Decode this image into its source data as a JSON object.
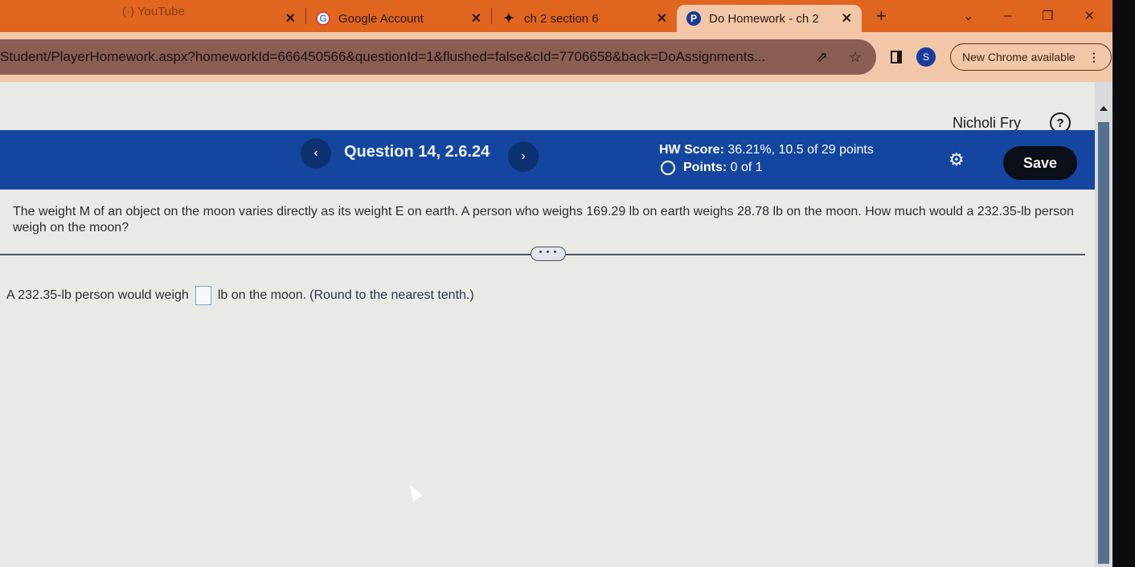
{
  "browser": {
    "tabs": [
      {
        "title": "(·) YouTube",
        "icon": "youtube-icon",
        "active": false,
        "partial": true
      },
      {
        "title": "Google Account",
        "icon": "google-icon",
        "active": false
      },
      {
        "title": "ch 2 section 6",
        "icon": "bird-icon",
        "active": false
      },
      {
        "title": "Do Homework - ch 2",
        "icon": "pearson-icon",
        "active": true
      }
    ],
    "tab_close_glyph": "✕",
    "new_tab_glyph": "+",
    "window_controls": {
      "dropdown": "⌄",
      "minimize": "–",
      "restore": "❐",
      "close": "✕"
    },
    "url": "Student/PlayerHomework.aspx?homeworkId=666450566&questionId=1&flushed=false&cId=7706658&back=DoAssignments...",
    "profile_initial": "S",
    "update_button": "New Chrome available",
    "menu_glyph": "⋮",
    "share_glyph": "⇗",
    "star_glyph": "☆"
  },
  "page": {
    "user_name": "Nicholi Fry",
    "help_glyph": "?",
    "question_title": "Question 14, 2.6.24",
    "prev_glyph": "‹",
    "next_glyph": "›",
    "hw_score_label": "HW Score:",
    "hw_score_value": "36.21%, 10.5 of 29 points",
    "points_label": "Points:",
    "points_value": "0 of 1",
    "settings_glyph": "⚙",
    "save_label": "Save",
    "question_text": "The weight M of an object on the moon varies directly as its weight E on earth. A person who weighs 169.29 lb on earth weighs 28.78 lb on the moon. How much would a 232.35-lb person weigh on the moon?",
    "more_label": "• • •",
    "answer_prefix": "A 232.35-lb person would weigh",
    "answer_value": "",
    "answer_suffix": "lb on the moon.",
    "answer_hint": "(Round to the nearest tenth.)"
  }
}
